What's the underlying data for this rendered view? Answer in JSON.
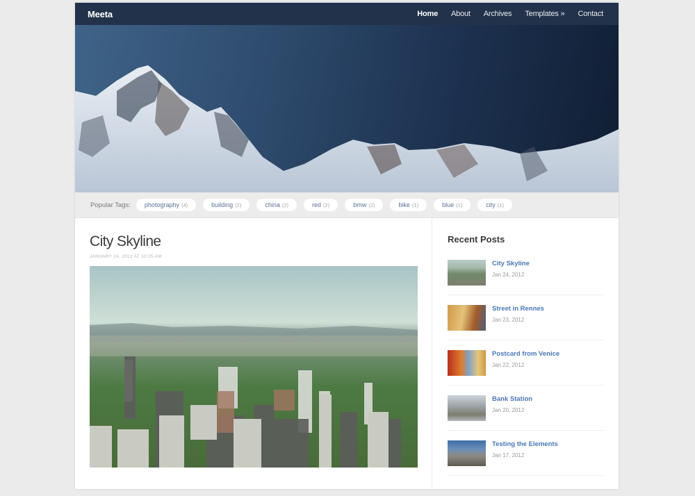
{
  "header": {
    "brand": "Meeta",
    "nav": [
      {
        "label": "Home",
        "active": true
      },
      {
        "label": "About"
      },
      {
        "label": "Archives"
      },
      {
        "label": "Templates »"
      },
      {
        "label": "Contact"
      }
    ]
  },
  "hero": {
    "image": "snowy-mountain-peaks"
  },
  "tags": {
    "label": "Popular Tags:",
    "items": [
      {
        "name": "photography",
        "count": "(4)"
      },
      {
        "name": "building",
        "count": "(2)"
      },
      {
        "name": "china",
        "count": "(2)"
      },
      {
        "name": "red",
        "count": "(2)"
      },
      {
        "name": "bmw",
        "count": "(2)"
      },
      {
        "name": "bike",
        "count": "(1)"
      },
      {
        "name": "blue",
        "count": "(1)"
      },
      {
        "name": "city",
        "count": "(1)"
      }
    ]
  },
  "post": {
    "title": "City Skyline",
    "meta": "JANUARY 24, 2012 AT 10:25 AM",
    "image": "city-skyline-aerial"
  },
  "sidebar": {
    "title": "Recent Posts",
    "posts": [
      {
        "title": "City Skyline",
        "date": "Jan 24, 2012",
        "thumb": "city"
      },
      {
        "title": "Street in Rennes",
        "date": "Jan 23, 2012",
        "thumb": "street"
      },
      {
        "title": "Postcard from Venice",
        "date": "Jan 22, 2012",
        "thumb": "venice"
      },
      {
        "title": "Bank Station",
        "date": "Jan 20, 2012",
        "thumb": "bank"
      },
      {
        "title": "Testing the Elements",
        "date": "Jan 17, 2012",
        "thumb": "mountain"
      }
    ]
  }
}
